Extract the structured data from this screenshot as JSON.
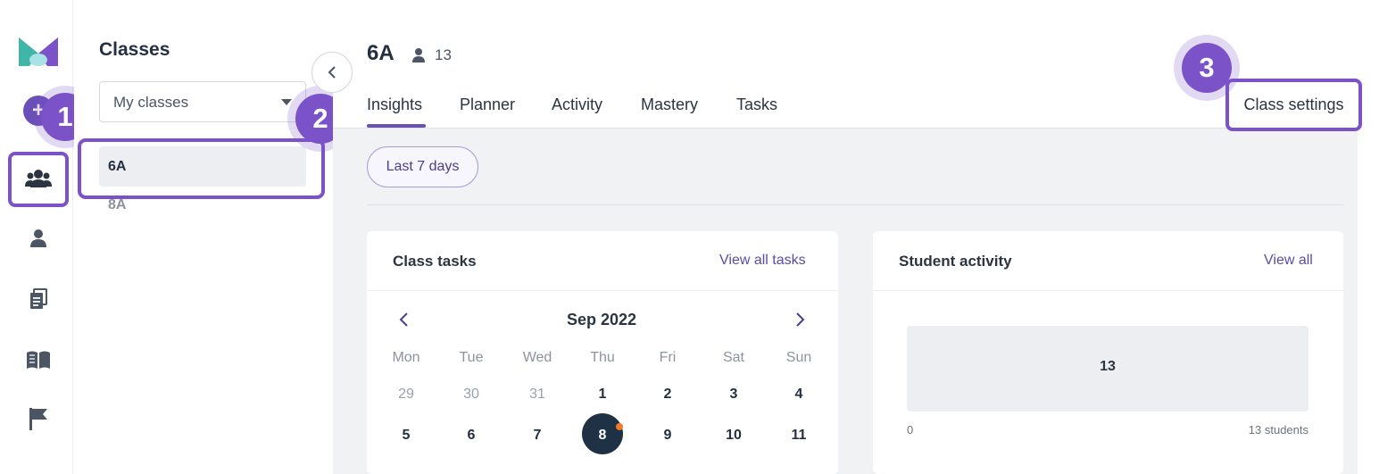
{
  "sidebar": {
    "add_symbol": "+",
    "icons": [
      "add-icon",
      "people-icon",
      "person-icon",
      "documents-icon",
      "book-icon",
      "flag-icon"
    ]
  },
  "classes_panel": {
    "title": "Classes",
    "filter": {
      "selected": "My classes"
    },
    "classes": [
      {
        "label": "6A",
        "active": true
      },
      {
        "label": "8A",
        "active": false
      }
    ]
  },
  "header": {
    "class_name": "6A",
    "student_count": "13",
    "tabs": [
      {
        "label": "Insights",
        "active": true
      },
      {
        "label": "Planner"
      },
      {
        "label": "Activity"
      },
      {
        "label": "Mastery"
      },
      {
        "label": "Tasks"
      }
    ],
    "settings_label": "Class settings"
  },
  "date_filter": "Last 7 days",
  "class_tasks": {
    "title": "Class tasks",
    "link": "View all tasks",
    "month": "Sep 2022",
    "weekdays": [
      "Mon",
      "Tue",
      "Wed",
      "Thu",
      "Fri",
      "Sat",
      "Sun"
    ],
    "week1": [
      "29",
      "30",
      "31",
      "1",
      "2",
      "3",
      "4"
    ],
    "week2": [
      "5",
      "6",
      "7",
      "8",
      "9",
      "10",
      "11"
    ],
    "today": "8"
  },
  "student_activity": {
    "title": "Student activity",
    "link": "View all",
    "bar_value": "13",
    "axis_min": "0",
    "axis_max": "13 students"
  },
  "callouts": [
    "1",
    "2",
    "3"
  ],
  "colors": {
    "accent": "#7b52c7",
    "brand_purple": "#6b4fb8",
    "link": "#5b4aa6",
    "today": "#1f3145",
    "task_dot": "#f07a2a"
  }
}
